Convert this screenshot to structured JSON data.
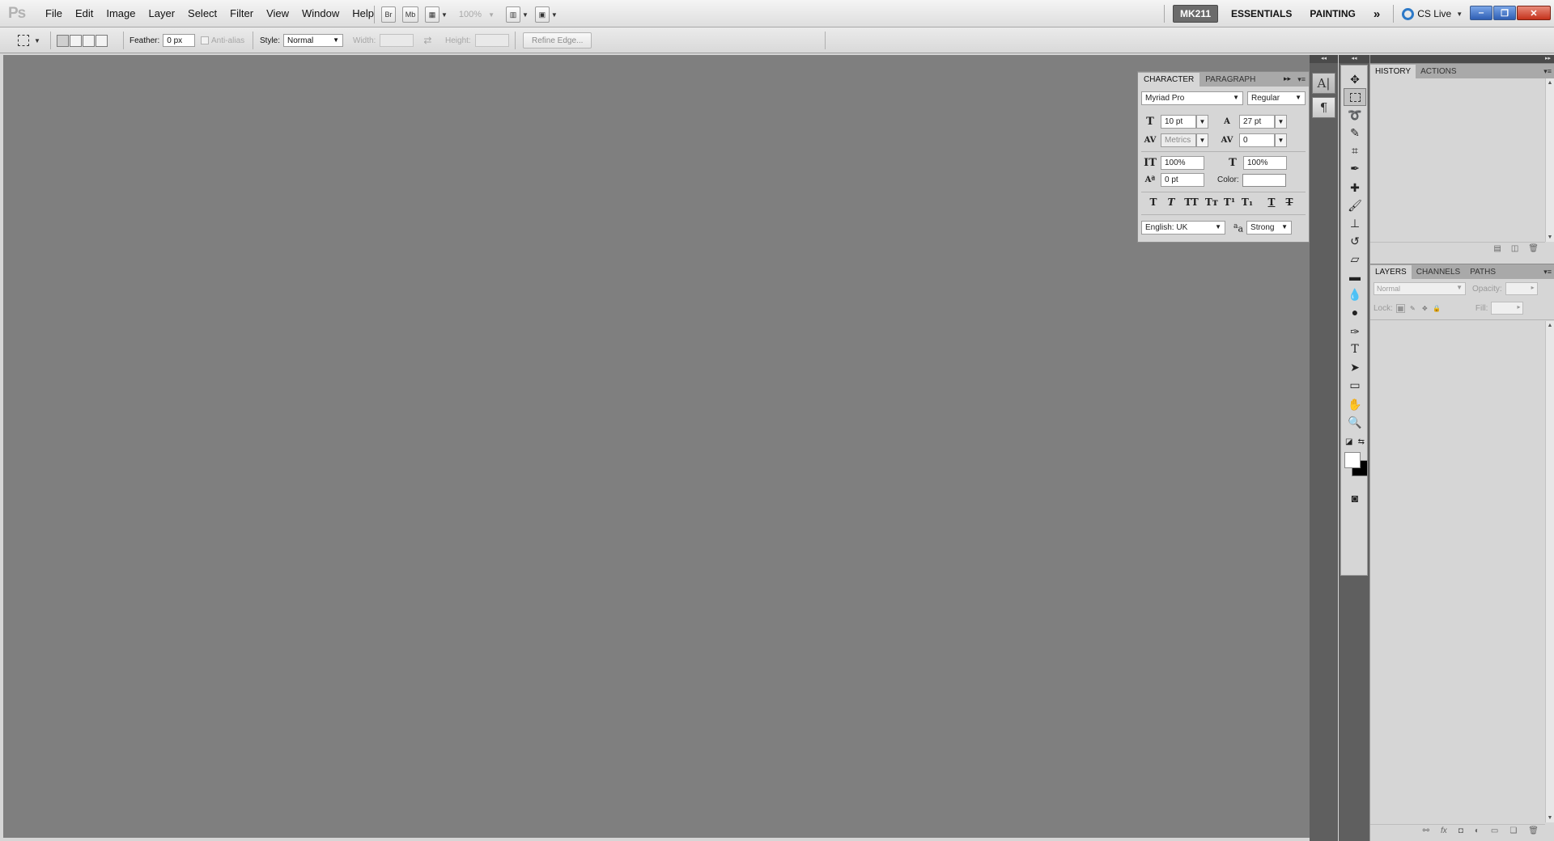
{
  "app": {
    "logo": "Ps",
    "menu": [
      "File",
      "Edit",
      "Image",
      "Layer",
      "Select",
      "Filter",
      "View",
      "Window",
      "Help"
    ],
    "bridge_label": "Br",
    "minibridge_label": "Mb",
    "zoom": "100%",
    "workspaces": {
      "current": "MK211",
      "essentials": "ESSENTIALS",
      "painting": "PAINTING",
      "more": "»"
    },
    "cs_live": "CS Live"
  },
  "options": {
    "feather_label": "Feather:",
    "feather_value": "0 px",
    "antialias_label": "Anti-alias",
    "style_label": "Style:",
    "style_value": "Normal",
    "width_label": "Width:",
    "height_label": "Height:",
    "refine_edge": "Refine Edge..."
  },
  "character": {
    "tabs": [
      "CHARACTER",
      "PARAGRAPH"
    ],
    "font_family": "Myriad Pro",
    "font_style": "Regular",
    "font_size": "10 pt",
    "leading": "27 pt",
    "kerning": "Metrics",
    "tracking": "0",
    "vertical_scale": "100%",
    "horizontal_scale": "100%",
    "baseline_shift": "0 pt",
    "color_label": "Color:",
    "language": "English: UK",
    "antialias": "Strong",
    "antialias_icon_text": "a",
    "antialias_icon_text2": "a"
  },
  "dock": {
    "history_tabs": [
      "HISTORY",
      "ACTIONS"
    ],
    "layers_tabs": [
      "LAYERS",
      "CHANNELS",
      "PATHS"
    ],
    "blend_mode": "Normal",
    "opacity_label": "Opacity:",
    "lock_label": "Lock:",
    "fill_label": "Fill:"
  },
  "colors": {
    "canvas": "#7f7f7f",
    "panel": "#d6d6d6",
    "dark_strip": "#5f5f5f",
    "workspace_active": "#6b6b6b"
  }
}
